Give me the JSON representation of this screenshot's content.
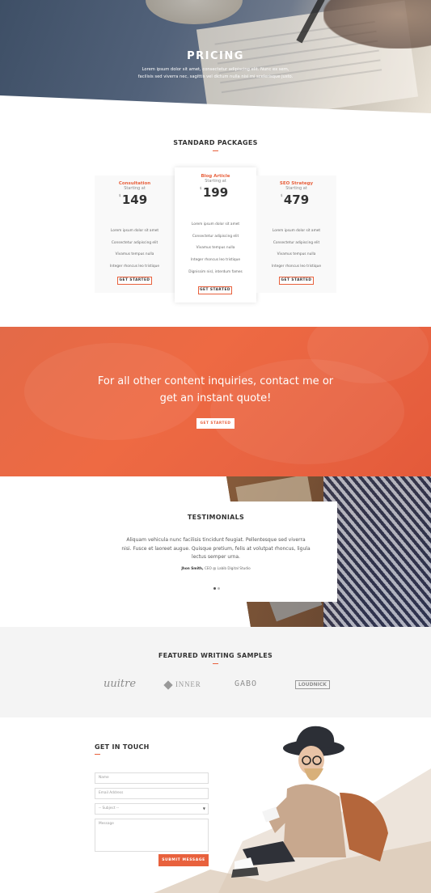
{
  "hero": {
    "title": "PRICING",
    "subtitle": "Lorem ipsum dolor sit amet, consectetur adipiscing elit. Nunc ex sem, facilisis sed viverra nec, sagittis vel dictum nulla nisi mi scelerisque justo."
  },
  "packages": {
    "section_title": "STANDARD PACKAGES",
    "items": [
      {
        "name": "Consultation",
        "starting": "Starting at",
        "currency": "$",
        "price": "149",
        "features": [
          "Lorem ipsum dolor sit amet",
          "Consectetur adipiscing elit",
          "Vivamus tempus nulla",
          "Integer rhoncus leo tristique"
        ],
        "button": "GET STARTED"
      },
      {
        "name": "Blog Article",
        "starting": "Starting at",
        "currency": "$",
        "price": "199",
        "features": [
          "Lorem ipsum dolor sit amet",
          "Consectetur adipiscing elit",
          "Vivamus tempus nulla",
          "Integer rhoncus leo tristique",
          "Dignissim nisl, interdum fames"
        ],
        "button": "GET STARTED"
      },
      {
        "name": "SEO Strategy",
        "starting": "Starting at",
        "currency": "$",
        "price": "479",
        "features": [
          "Lorem ipsum dolor sit amet",
          "Consectetur adipiscing elit",
          "Vivamus tempus nulla",
          "Integer rhoncus leo tristique"
        ],
        "button": "GET STARTED"
      }
    ]
  },
  "cta": {
    "line1": "For all other content inquiries, contact me or",
    "line2": "get an instant quote!",
    "button": "GET STARTED"
  },
  "testimonials": {
    "title": "TESTIMONIALS",
    "quote": "Aliquam vehicula nunc facilisis tincidunt feugiat. Pellentesque sed viverra nisi. Fusce et laoreet augue. Quisque pretium, felis at volutpat rhoncus, ligula lectus semper urna.",
    "author_name": "Jhon Smith,",
    "author_role": "CEO @ Labib Digital Studio"
  },
  "samples": {
    "title": "FEATURED WRITING SAMPLES",
    "logos": [
      "uuitre",
      "INNER",
      "GABO",
      "LOUDNICK"
    ]
  },
  "contact": {
    "title": "GET IN TOUCH",
    "name_placeholder": "Name",
    "email_placeholder": "Email Address",
    "subject_placeholder": "-- Subject --",
    "message_placeholder": "Message",
    "submit": "SUBMIT MESSAGE"
  },
  "colors": {
    "accent": "#e8613d",
    "hero_overlay": "#4a5a70",
    "samples_bg": "#f4f4f4"
  }
}
